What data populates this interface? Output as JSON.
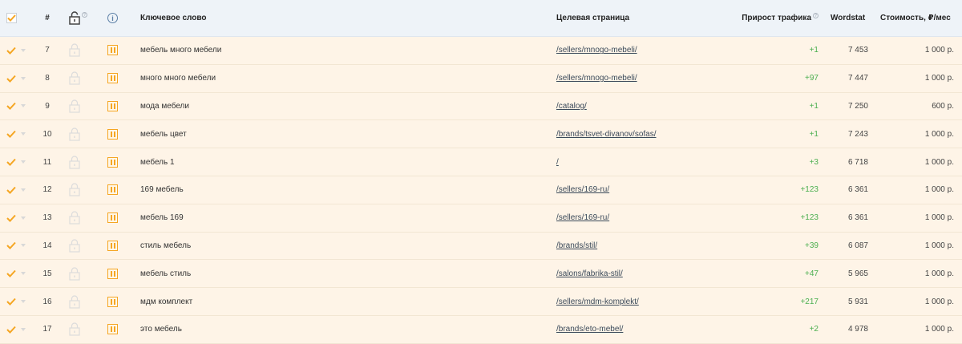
{
  "header": {
    "num": "#",
    "keyword": "Ключевое слово",
    "target_page": "Целевая страница",
    "traffic": "Прирост трафика",
    "wordstat": "Wordstat",
    "cost": "Стоимость, ₽/мес",
    "lock_icon": "lock-icon",
    "info_icon": "info-icon",
    "info_glyph": "i"
  },
  "colors": {
    "check": "#f5a623",
    "pause": "#f5a623",
    "traffic": "#4caf50",
    "row_bg": "#fef4e7",
    "header_bg": "#eef3f8"
  },
  "rows": [
    {
      "num": "7",
      "keyword": "мебель много мебели",
      "url": "/sellers/mnogo-mebeli/",
      "traffic": "+1",
      "wordstat": "7 453",
      "cost": "1 000 р."
    },
    {
      "num": "8",
      "keyword": "много много мебели",
      "url": "/sellers/mnogo-mebeli/",
      "traffic": "+97",
      "wordstat": "7 447",
      "cost": "1 000 р."
    },
    {
      "num": "9",
      "keyword": "мода мебели",
      "url": "/catalog/",
      "traffic": "+1",
      "wordstat": "7 250",
      "cost": "600 р."
    },
    {
      "num": "10",
      "keyword": "мебель цвет",
      "url": "/brands/tsvet-divanov/sofas/",
      "traffic": "+1",
      "wordstat": "7 243",
      "cost": "1 000 р."
    },
    {
      "num": "11",
      "keyword": "мебель 1",
      "url": "/",
      "traffic": "+3",
      "wordstat": "6 718",
      "cost": "1 000 р."
    },
    {
      "num": "12",
      "keyword": "169 мебель",
      "url": "/sellers/169-ru/",
      "traffic": "+123",
      "wordstat": "6 361",
      "cost": "1 000 р."
    },
    {
      "num": "13",
      "keyword": "мебель 169",
      "url": "/sellers/169-ru/",
      "traffic": "+123",
      "wordstat": "6 361",
      "cost": "1 000 р."
    },
    {
      "num": "14",
      "keyword": "стиль мебель",
      "url": "/brands/stil/",
      "traffic": "+39",
      "wordstat": "6 087",
      "cost": "1 000 р."
    },
    {
      "num": "15",
      "keyword": "мебель стиль",
      "url": "/salons/fabrika-stil/",
      "traffic": "+47",
      "wordstat": "5 965",
      "cost": "1 000 р."
    },
    {
      "num": "16",
      "keyword": "мдм комплект",
      "url": "/sellers/mdm-komplekt/",
      "traffic": "+217",
      "wordstat": "5 931",
      "cost": "1 000 р."
    },
    {
      "num": "17",
      "keyword": "это мебель",
      "url": "/brands/eto-mebel/",
      "traffic": "+2",
      "wordstat": "4 978",
      "cost": "1 000 р."
    }
  ]
}
